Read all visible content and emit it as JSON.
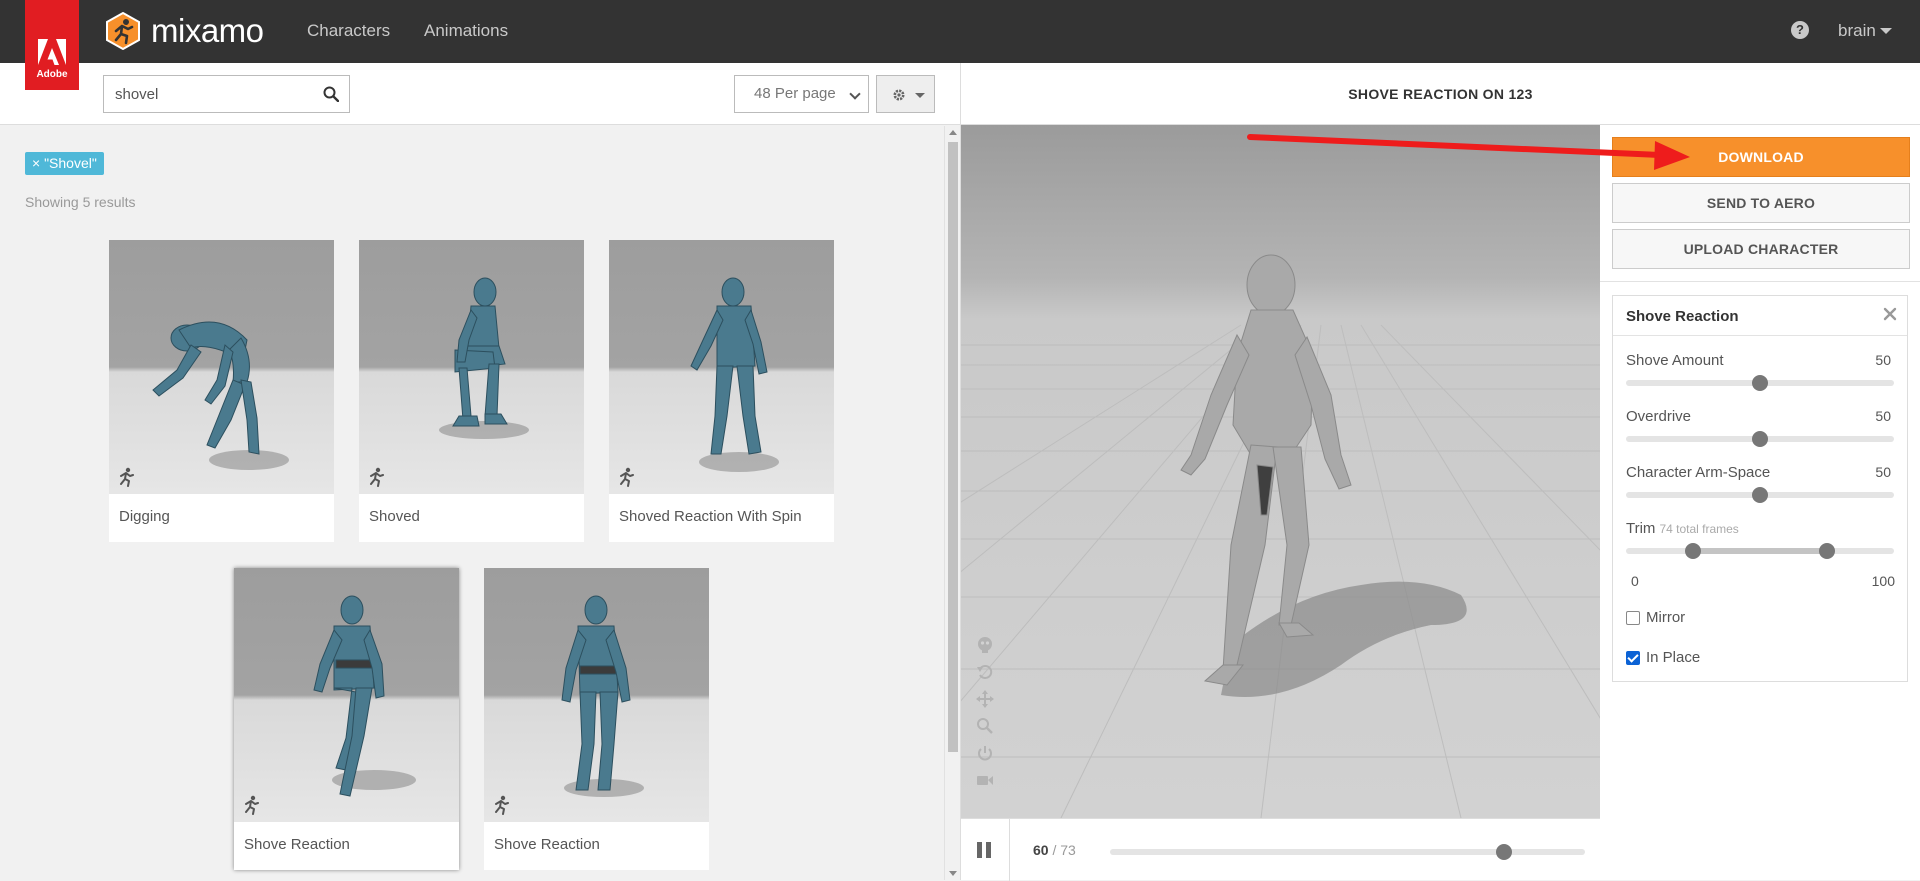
{
  "navbar": {
    "adobe_label": "Adobe",
    "logo_text": "mixamo",
    "links": [
      "Characters",
      "Animations"
    ],
    "help_label": "?",
    "user": "brain"
  },
  "search": {
    "value": "shovel",
    "per_page": "48 Per page"
  },
  "results": {
    "filter_tag": "× \"Shovel\"",
    "count_text": "Showing 5 results",
    "items": [
      {
        "label": "Digging"
      },
      {
        "label": "Shoved"
      },
      {
        "label": "Shoved Reaction With Spin"
      },
      {
        "label": "Shove Reaction"
      },
      {
        "label": "Shove Reaction"
      }
    ]
  },
  "viewer": {
    "title": "SHOVE REACTION ON 123",
    "current_frame": "60",
    "frame_separator": "/ 73",
    "timeline_progress": 0.83
  },
  "actions": {
    "download": "DOWNLOAD",
    "send_to_aero": "SEND TO AERO",
    "upload_character": "UPLOAD CHARACTER"
  },
  "settings": {
    "title": "Shove Reaction",
    "params": [
      {
        "label": "Shove Amount",
        "value": "50",
        "fraction": 0.5
      },
      {
        "label": "Overdrive",
        "value": "50",
        "fraction": 0.5
      },
      {
        "label": "Character Arm-Space",
        "value": "50",
        "fraction": 0.5
      }
    ],
    "trim": {
      "label": "Trim",
      "note": "74 total frames",
      "start": 0.25,
      "end": 0.75,
      "min_label": "0",
      "max_label": "100"
    },
    "mirror": {
      "label": "Mirror",
      "checked": false
    },
    "in_place": {
      "label": "In Place",
      "checked": true
    }
  },
  "colors": {
    "accent": "#f7902b",
    "tag": "#4fb8d8",
    "adobe_red": "#e11d22",
    "navbar": "#333333"
  }
}
